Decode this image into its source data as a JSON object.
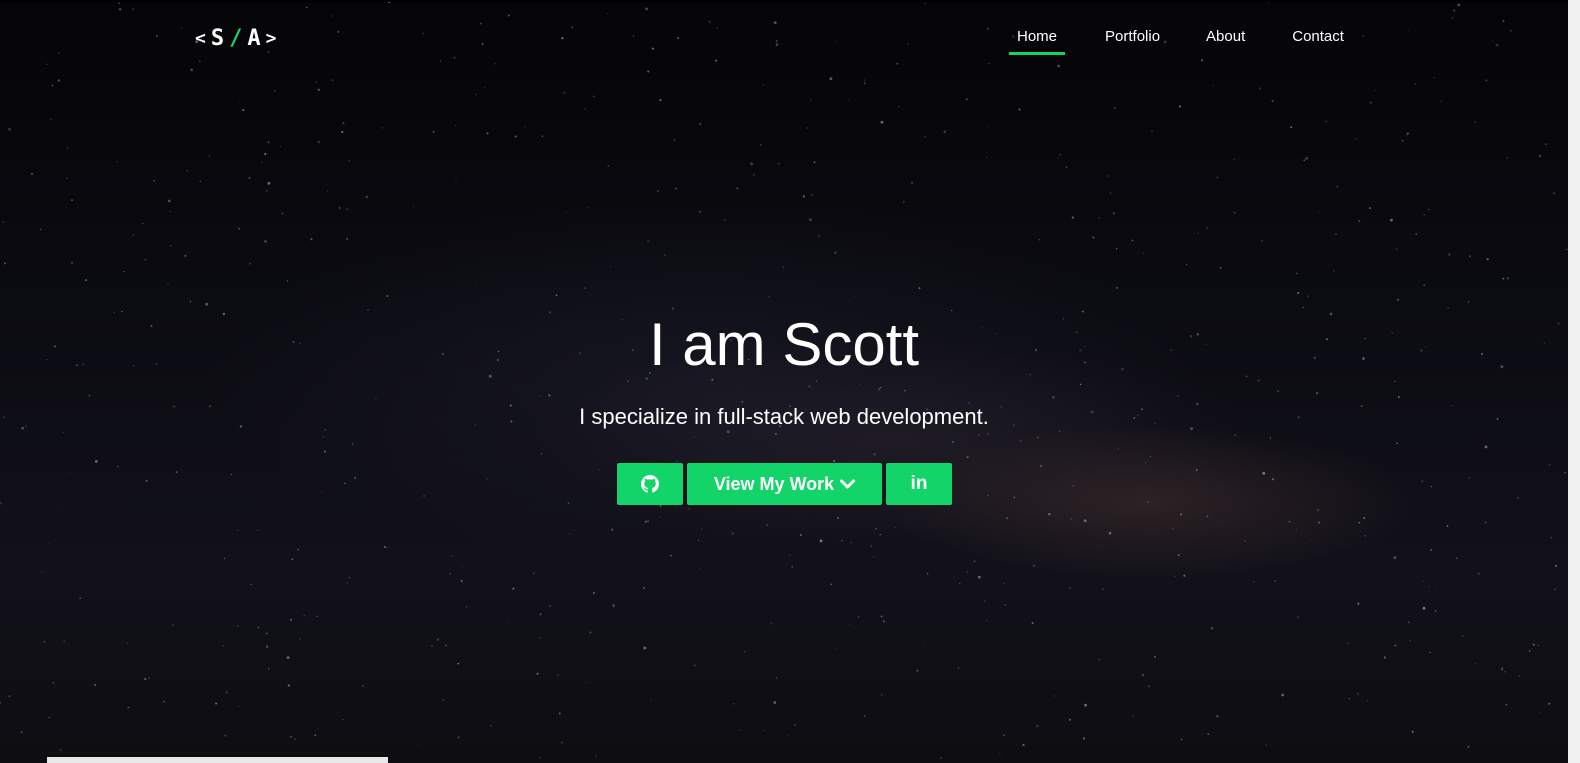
{
  "logo": {
    "left": "<",
    "s": "S",
    "slash": "/",
    "a": "A",
    "right": ">"
  },
  "nav": {
    "items": [
      {
        "label": "Home",
        "active": true
      },
      {
        "label": "Portfolio",
        "active": false
      },
      {
        "label": "About",
        "active": false
      },
      {
        "label": "Contact",
        "active": false
      }
    ]
  },
  "hero": {
    "title": "I am Scott",
    "subtitle": "I specialize in full-stack web development.",
    "buttons": {
      "github_icon": "github-icon",
      "work_label": "View My Work",
      "work_icon": "chevron-down-icon",
      "linkedin_label": "in"
    }
  },
  "colors": {
    "accent": "#13d468",
    "background": "#0a0a10",
    "text": "#ffffff"
  }
}
